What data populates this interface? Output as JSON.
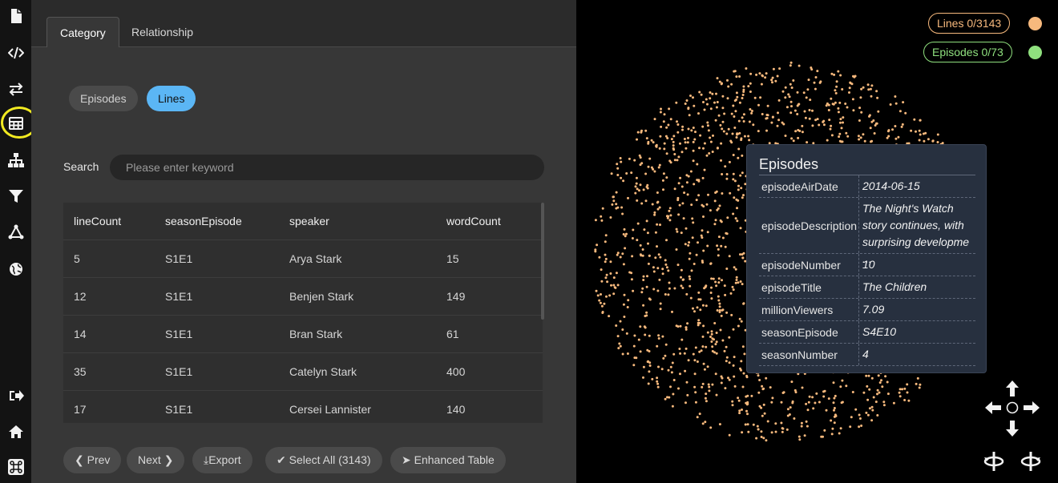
{
  "sidebar": {
    "icons": [
      "document-icon",
      "code-icon",
      "swap-arrows-icon",
      "table-icon",
      "hierarchy-icon",
      "filter-icon",
      "network-icon",
      "globe-icon",
      "logout-icon",
      "home-icon",
      "command-icon"
    ],
    "highlighted": "table-icon",
    "highlight_color": "#f2ea21"
  },
  "tabs": {
    "category": "Category",
    "relationship": "Relationship"
  },
  "categories": {
    "episodes": "Episodes",
    "lines": "Lines",
    "selected": "Lines"
  },
  "search": {
    "label": "Search",
    "placeholder": "Please enter keyword"
  },
  "table": {
    "columns": [
      "lineCount",
      "seasonEpisode",
      "speaker",
      "wordCount"
    ],
    "rows": [
      [
        "5",
        "S1E1",
        "Arya Stark",
        "15"
      ],
      [
        "12",
        "S1E1",
        "Benjen Stark",
        "149"
      ],
      [
        "14",
        "S1E1",
        "Bran Stark",
        "61"
      ],
      [
        "35",
        "S1E1",
        "Catelyn Stark",
        "400"
      ],
      [
        "17",
        "S1E1",
        "Cersei Lannister",
        "140"
      ]
    ]
  },
  "buttons": {
    "prev": "Prev",
    "next": "Next",
    "export": "Export",
    "select_all": "Select All (3143)",
    "enhanced_table": "Enhanced Table"
  },
  "legend": [
    {
      "label": "Lines 0/3143",
      "color": "#f7b97d"
    },
    {
      "label": "Episodes 0/73",
      "color": "#8fe07e"
    }
  ],
  "tooltip": {
    "title": "Episodes",
    "rows": [
      {
        "key": "episodeAirDate",
        "value": "2014-06-15"
      },
      {
        "key": "episodeDescription",
        "value": "The Night's Watch story continues, with surprising developme ..."
      },
      {
        "key": "episodeNumber",
        "value": "10"
      },
      {
        "key": "episodeTitle",
        "value": "The Children"
      },
      {
        "key": "millionViewers",
        "value": "7.09"
      },
      {
        "key": "seasonEpisode",
        "value": "S4E10"
      },
      {
        "key": "seasonNumber",
        "value": "4"
      }
    ]
  },
  "colors": {
    "node": "#f7b97d",
    "accent_pill": "#5bb6f5",
    "panel_bg": "#373737"
  },
  "controls": [
    "arrow-up-icon",
    "arrow-left-icon",
    "center-icon",
    "arrow-right-icon",
    "arrow-down-icon",
    "rotate-left-icon",
    "rotate-right-icon"
  ]
}
